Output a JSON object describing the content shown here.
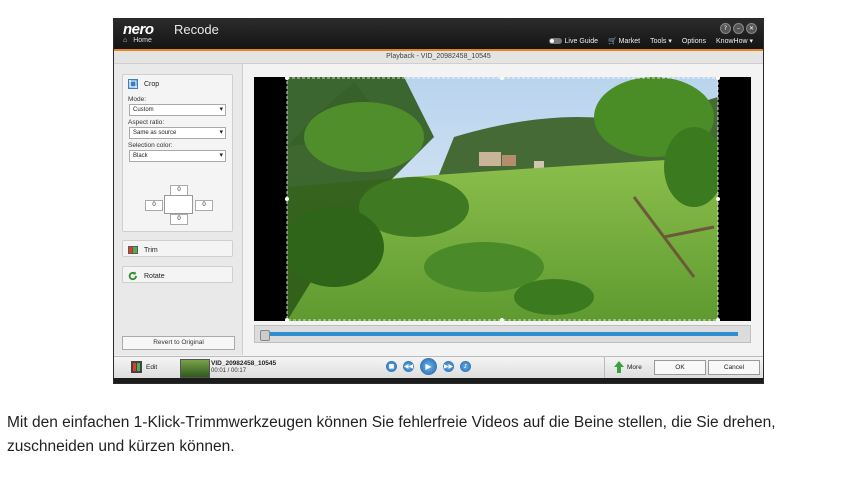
{
  "app": {
    "logo": "nero",
    "product": "Recode",
    "home_label": "Home",
    "window_buttons": [
      "?",
      "–",
      "✕"
    ],
    "nav": {
      "live_guide": "Live Guide",
      "market": "Market",
      "tools": "Tools ▾",
      "options": "Options",
      "knowhow": "KnowHow ▾"
    },
    "playback_title": "Playback - VID_20982458_10545"
  },
  "panel": {
    "crop": {
      "title": "Crop",
      "mode_label": "Mode:",
      "mode_value": "Custom",
      "aspect_label": "Aspect ratio:",
      "aspect_value": "Same as source",
      "color_label": "Selection color:",
      "color_value": "Black",
      "offsets": {
        "top": "0",
        "left": "0",
        "right": "0",
        "bottom": "0"
      }
    },
    "trim": "Trim",
    "rotate": "Rotate",
    "revert": "Revert to Original"
  },
  "bottom": {
    "edit": "Edit",
    "file_name": "VID_20982458_10545",
    "time": "00:01 / 00:17",
    "more": "More",
    "ok": "OK",
    "cancel": "Cancel"
  },
  "colors": {
    "accent": "#e9831b",
    "timeline": "#2d8fd0",
    "titlebar": "#1a1a1a"
  },
  "caption": "Mit den einfachen 1-Klick-Trimmwerkzeugen können Sie fehlerfreie Videos auf die Beine stellen, die Sie drehen, zuschneiden und kürzen können."
}
